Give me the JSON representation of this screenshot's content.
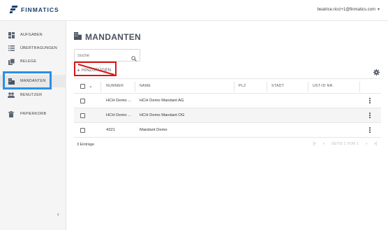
{
  "app": {
    "brand": "FINMATICS",
    "user_email": "beatrice.ricci+1@finmatics.com"
  },
  "sidebar": {
    "items": [
      {
        "label": "AUFGABEN",
        "icon": "dashboard-icon"
      },
      {
        "label": "ÜBERTRAGUNGEN",
        "icon": "list-icon"
      },
      {
        "label": "BELEGE",
        "icon": "documents-icon"
      },
      {
        "label": "MANDANTEN",
        "icon": "building-icon"
      },
      {
        "label": "BENUTZER",
        "icon": "users-icon"
      },
      {
        "label": "PAPIERKORB",
        "icon": "trash-icon"
      }
    ],
    "active": "MANDANTEN",
    "collapse_glyph": "‹"
  },
  "page": {
    "title": "MANDANTEN",
    "search_placeholder": "Suche",
    "add_label": "HINZUFÜGEN"
  },
  "table": {
    "columns": [
      "NUMMER",
      "NAME",
      "PLZ",
      "STADT",
      "UST-ID NR."
    ],
    "rows": [
      {
        "nummer": "HCH Demo ...",
        "name": "HCH Demo Mandant AG",
        "plz": "",
        "stadt": "",
        "ust": ""
      },
      {
        "nummer": "HCH Demo ...",
        "name": "HCH Demo Mandant OG",
        "plz": "",
        "stadt": "",
        "ust": ""
      },
      {
        "nummer": "4321",
        "name": "Mandant Demo",
        "plz": "",
        "stadt": "",
        "ust": ""
      }
    ]
  },
  "footer": {
    "count_label": "3 Einträge",
    "page_info": "SEITE 1 VON 1"
  },
  "colors": {
    "brand": "#1e3d6b",
    "highlight_blue": "#2b8fe6",
    "annotation_red": "#d6161b"
  }
}
